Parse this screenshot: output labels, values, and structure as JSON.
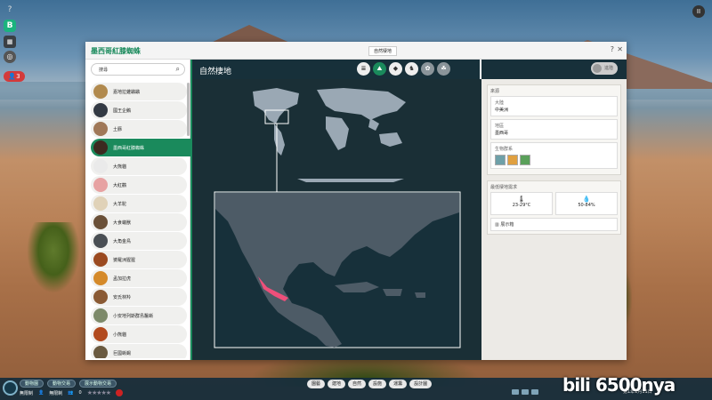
{
  "left_toolbar": {
    "help_label": "?",
    "b_label": "B",
    "c_label": "▦",
    "d_label": "◎",
    "alert_count": "3"
  },
  "pause_label": "II",
  "dialog": {
    "title": "墨西哥紅膝蜘蛛",
    "tab_label": "自然棲地",
    "help_label": "?",
    "close_label": "✕"
  },
  "sidebar": {
    "search_value": "搜尋",
    "animals": [
      {
        "name": "嘉地拉雞鶘鶘",
        "color": "#b18a4e"
      },
      {
        "name": "國王企鵝",
        "color": "#333a44"
      },
      {
        "name": "土豚",
        "color": "#a07858"
      },
      {
        "name": "墨西哥紅膝蜘蛛",
        "color": "#3c2a20"
      },
      {
        "name": "大熊貓",
        "color": "#eaeaea"
      },
      {
        "name": "大紅鸛",
        "color": "#e7a2a2"
      },
      {
        "name": "大羊駝",
        "color": "#e0d2b8"
      },
      {
        "name": "大食蟻獸",
        "color": "#6a5038"
      },
      {
        "name": "大角金鳥",
        "color": "#4a4f54"
      },
      {
        "name": "婆羅洲猩猩",
        "color": "#9b4a20"
      },
      {
        "name": "孟加拉虎",
        "color": "#d58a2a"
      },
      {
        "name": "安氏林羚",
        "color": "#8a5a34"
      },
      {
        "name": "小安地列斯群島鬣蜥",
        "color": "#7d8a6a"
      },
      {
        "name": "小熊貓",
        "color": "#b24a1e"
      },
      {
        "name": "巨國蜥蜴",
        "color": "#6a5a40"
      }
    ]
  },
  "main": {
    "title": "自然棲地",
    "tabs": [
      "≣",
      "⛰",
      "◆",
      "♞",
      "✿",
      "☘"
    ]
  },
  "right_panel": {
    "user_button": "進階",
    "origin_header": "來源",
    "continent_label": "大陸",
    "continent_value": "中美洲",
    "region_label": "地區",
    "region_value": "墨西哥",
    "biome_label": "生物群系",
    "biome_colors": [
      "#6ea0a8",
      "#e0a040",
      "#5aa05a"
    ],
    "env_header": "最低棲地需求",
    "temp_value": "23-29°C",
    "humidity_value": "50-84%",
    "env_foot": "展示箱",
    "temp_icon": "🌡",
    "humidity_icon": "💧"
  },
  "bottom": {
    "pills": [
      "動物園",
      "動物交易",
      "展示動物交易"
    ],
    "money": "無限制",
    "guests": "無限制",
    "guests_count": "0",
    "stars": "★★★★★",
    "menu": [
      "園藝",
      "建地",
      "自然",
      "設施",
      "運籌",
      "設計圖"
    ],
    "date": "第1年1月11日"
  },
  "watermark": "6500nya"
}
